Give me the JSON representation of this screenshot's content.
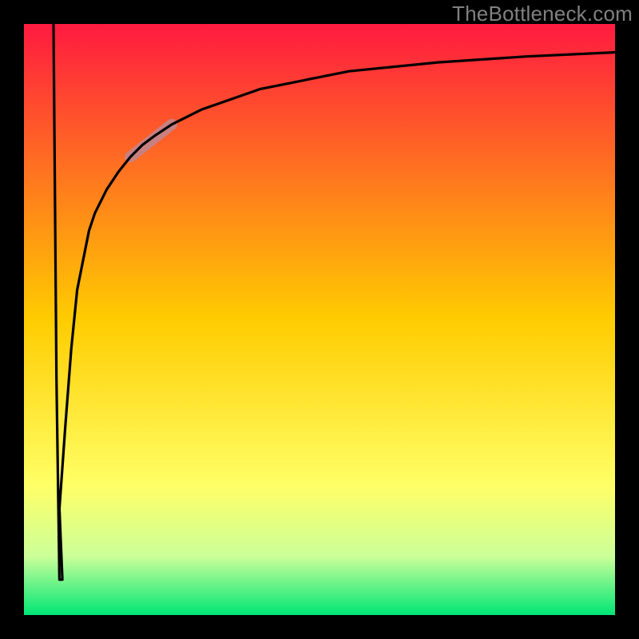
{
  "credit": "TheBottleneck.com",
  "chart_data": {
    "type": "line",
    "title": "",
    "xlabel": "",
    "ylabel": "",
    "xlim": [
      0,
      100
    ],
    "ylim": [
      0,
      100
    ],
    "grid": false,
    "legend": false,
    "background_gradient": {
      "stops": [
        {
          "pos": 0.0,
          "color": "#ff1a40"
        },
        {
          "pos": 0.5,
          "color": "#ffcc00"
        },
        {
          "pos": 0.78,
          "color": "#ffff66"
        },
        {
          "pos": 0.9,
          "color": "#ccff99"
        },
        {
          "pos": 1.0,
          "color": "#00e676"
        }
      ]
    },
    "series": [
      {
        "name": "curve",
        "x": [
          5,
          5.5,
          6,
          6.5,
          6,
          7,
          8,
          9,
          10,
          11,
          12,
          14,
          16,
          18,
          20,
          22,
          25,
          30,
          40,
          55,
          70,
          85,
          100
        ],
        "y": [
          100,
          40,
          6,
          6,
          18,
          32,
          45,
          55,
          60,
          65,
          68,
          72,
          75,
          77.5,
          79.5,
          81,
          83,
          85.5,
          89,
          92,
          93.5,
          94.5,
          95.2
        ]
      }
    ],
    "will_bottleneck_segment": {
      "x_start": 18,
      "y_start": 77.5,
      "x_end": 25,
      "y_end": 83
    },
    "frame_color": "#000000",
    "frame_thickness_px": 30,
    "line_color": "#000000",
    "highlight_color": "#c98080"
  }
}
